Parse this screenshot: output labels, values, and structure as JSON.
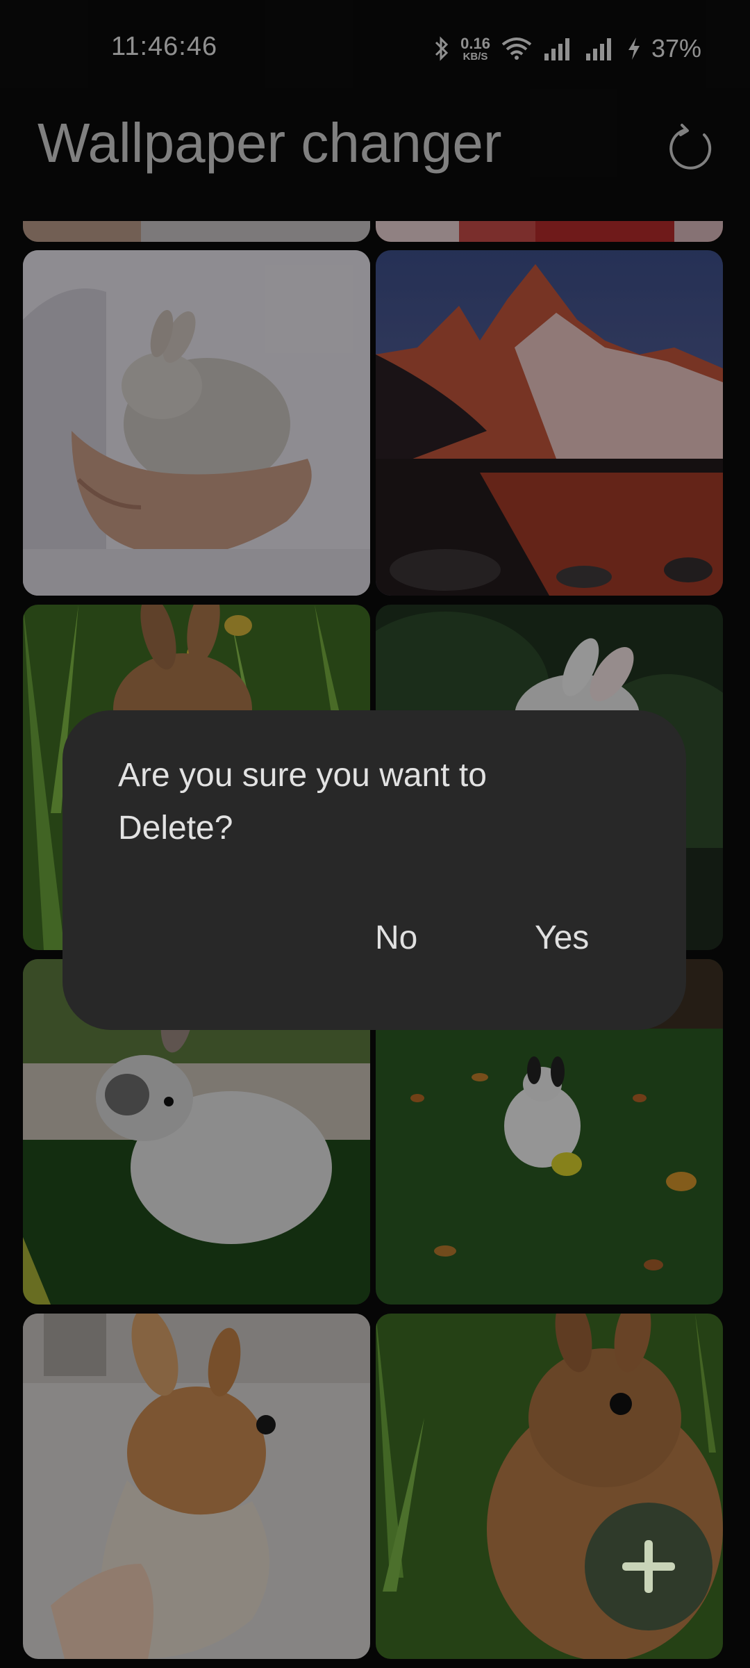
{
  "status_bar": {
    "time": "11:46:46",
    "net_speed_value": "0.16",
    "net_speed_unit": "KB/S",
    "battery": "37%"
  },
  "app_bar": {
    "title": "Wallpaper changer",
    "refresh_icon": "refresh-icon"
  },
  "grid": {
    "images": [
      "partial-top-left",
      "partial-top-right",
      "bunny-held-in-hand",
      "red-mountain-lake",
      "bunny-in-grass-peeking",
      "bunny-forest-ears",
      "white-grey-bunny-on-lawn",
      "white-bunny-leaves",
      "bunny-held-close",
      "brown-bunny-grass"
    ]
  },
  "dialog": {
    "message": "Are you sure you want to Delete?",
    "no_label": "No",
    "yes_label": "Yes"
  },
  "fab": {
    "icon": "plus-icon"
  },
  "colors": {
    "background": "#0b0b0b",
    "dialog": "#282828",
    "fab": "#2f3a2a"
  }
}
